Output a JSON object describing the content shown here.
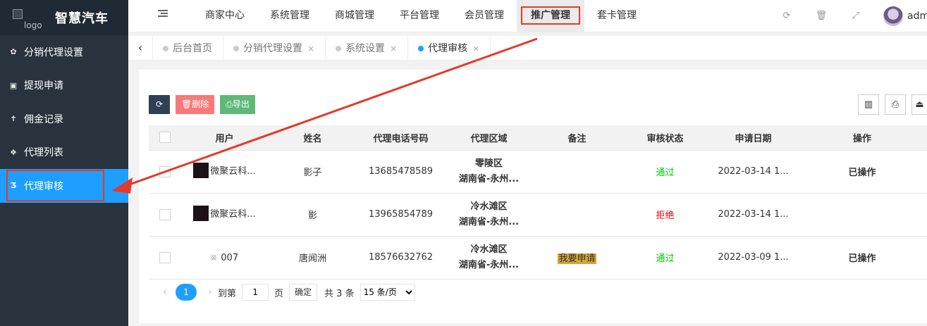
{
  "sidebar": {
    "logo_alt": "logo",
    "brand": "智慧汽车",
    "items": [
      {
        "label": "分销代理设置",
        "icon": "gear-icon",
        "glyph": "✿"
      },
      {
        "label": "提现申请",
        "icon": "money-icon",
        "glyph": "▣"
      },
      {
        "label": "佣金记录",
        "icon": "person-icon",
        "glyph": "✝"
      },
      {
        "label": "代理列表",
        "icon": "users-icon",
        "glyph": "❖"
      },
      {
        "label": "代理审核",
        "icon": "html5-icon",
        "glyph": "Ʒ",
        "active": true
      }
    ]
  },
  "header": {
    "nav": [
      "商家中心",
      "系统管理",
      "商城管理",
      "平台管理",
      "会员管理",
      "推广管理",
      "套卡管理"
    ],
    "active_nav": "推广管理",
    "username": "admin"
  },
  "tabs": {
    "prev": "‹",
    "items": [
      {
        "label": "后台首页",
        "closable": false
      },
      {
        "label": "分销代理设置",
        "closable": true
      },
      {
        "label": "系统设置",
        "closable": true
      },
      {
        "label": "代理审核",
        "closable": true,
        "active": true
      }
    ],
    "close_glyph": "×"
  },
  "toolbar": {
    "delete_label": "🗑删除",
    "export_label": "⎙导出"
  },
  "table": {
    "columns": [
      "用户",
      "姓名",
      "代理电话号码",
      "代理区域",
      "备注",
      "审核状态",
      "申请日期",
      "操作"
    ],
    "rows": [
      {
        "user": "微聚云科...",
        "name": "影子",
        "phone": "13685478589",
        "district": "零陵区",
        "province": "湖南省-永州...",
        "remark": "",
        "status": "通过",
        "status_type": "ok",
        "date": "2022-03-14 1...",
        "op": "已操作"
      },
      {
        "user": "微聚云科...",
        "name": "影",
        "phone": "13965854789",
        "district": "冷水滩区",
        "province": "湖南省-永州...",
        "remark": "",
        "status": "拒绝",
        "status_type": "no",
        "date": "2022-03-14 1...",
        "op": ""
      },
      {
        "user": "007",
        "name": "唐闻洲",
        "phone": "18576632762",
        "district": "冷水滩区",
        "province": "湖南省-永州...",
        "remark": "我要申请",
        "status": "通过",
        "status_type": "ok",
        "date": "2022-03-09 1...",
        "op": "已操作"
      }
    ]
  },
  "pager": {
    "current": "1",
    "goto_prefix": "到第",
    "goto_value": "1",
    "goto_suffix": "页",
    "confirm": "确定",
    "total": "共 3 条",
    "per_page": "15 条/页"
  },
  "colors": {
    "accent": "#1e9fff",
    "sidebar_bg": "#28333e",
    "annotation_red": "#e23a2c",
    "status_ok": "#00c800",
    "status_no": "#e00000"
  }
}
